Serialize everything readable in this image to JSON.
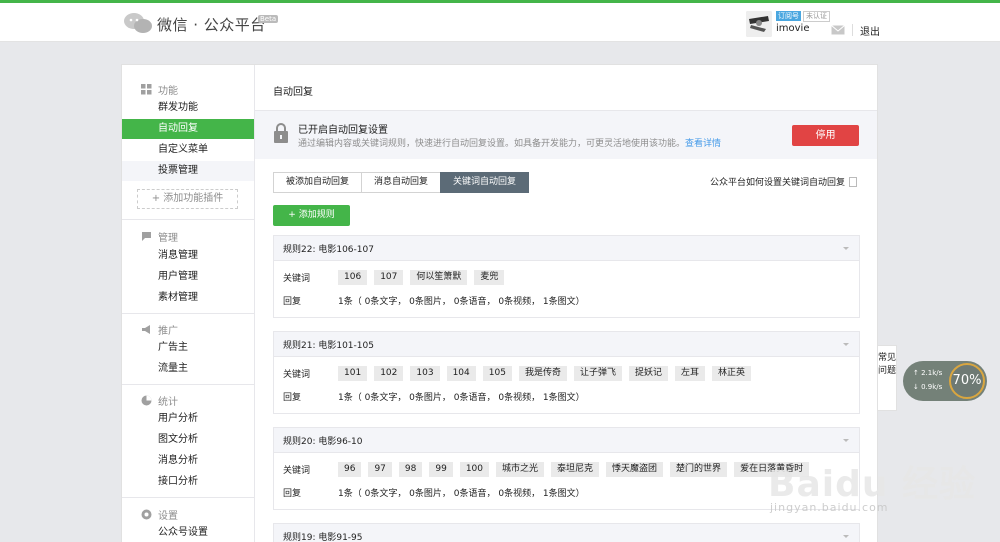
{
  "header": {
    "logo_text": "微信 · 公众平台",
    "beta": "Beta",
    "account_type": "订阅号",
    "verify": "未认证",
    "username": "imovie",
    "logout": "退出"
  },
  "sidebar": {
    "groups": [
      {
        "title": "功能",
        "icon": "grid-icon",
        "items": [
          "群发功能",
          "自动回复",
          "自定义菜单",
          "投票管理"
        ]
      },
      {
        "title": "管理",
        "icon": "chat-icon",
        "items": [
          "消息管理",
          "用户管理",
          "素材管理"
        ]
      },
      {
        "title": "推广",
        "icon": "megaphone-icon",
        "items": [
          "广告主",
          "流量主"
        ]
      },
      {
        "title": "统计",
        "icon": "pie-icon",
        "items": [
          "用户分析",
          "图文分析",
          "消息分析",
          "接口分析"
        ]
      },
      {
        "title": "设置",
        "icon": "gear-icon",
        "items": [
          "公众号设置"
        ]
      }
    ],
    "active_item": "自动回复",
    "add_plugin": "+ 添加功能插件"
  },
  "main": {
    "title": "自动回复",
    "notice": {
      "title": "已开启自动回复设置",
      "desc": "通过编辑内容或关键词规则，快速进行自动回复设置。如具备开发能力，可更灵活地使用该功能。",
      "link": "查看详情",
      "disable_button": "停用"
    },
    "tabs": [
      "被添加自动回复",
      "消息自动回复",
      "关键词自动回复"
    ],
    "active_tab": "关键词自动回复",
    "howto": "公众平台如何设置关键词自动回复",
    "add_rule": "添加规则",
    "keyword_label": "关键词",
    "reply_label": "回复",
    "rules": [
      {
        "title": "规则22: 电影106-107",
        "keywords": [
          "106",
          "107",
          "何以笙箫默",
          "麦兜"
        ],
        "reply": "1条（ 0条文字， 0条图片， 0条语音， 0条视频， 1条图文）"
      },
      {
        "title": "规则21: 电影101-105",
        "keywords": [
          "101",
          "102",
          "103",
          "104",
          "105",
          "我是传奇",
          "让子弹飞",
          "捉妖记",
          "左耳",
          "林正英"
        ],
        "reply": "1条（ 0条文字， 0条图片， 0条语音， 0条视频， 1条图文）"
      },
      {
        "title": "规则20: 电影96-10",
        "keywords": [
          "96",
          "97",
          "98",
          "99",
          "100",
          "城市之光",
          "泰坦尼克",
          "悸天魔盗团",
          "楚门的世界",
          "爱在日落黄昏时"
        ],
        "reply": "1条（ 0条文字， 0条图片， 0条语音， 0条视频， 1条图文）"
      },
      {
        "title": "规则19: 电影91-95",
        "keywords": [],
        "reply": ""
      }
    ]
  },
  "faq": "常见问题",
  "speed": {
    "up": "2.1k/s",
    "down": "0.9k/s",
    "percent": "70%"
  },
  "watermark": {
    "brand": "Baidu 经验",
    "url": "jingyan.baidu.com"
  }
}
